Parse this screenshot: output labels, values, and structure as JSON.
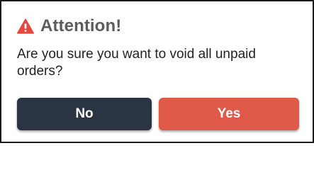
{
  "dialog": {
    "title": "Attention!",
    "icon": "warning-triangle-icon",
    "icon_color": "#e8453c",
    "message": "Are you sure you want to void all unpaid orders?",
    "buttons": {
      "no_label": "No",
      "yes_label": "Yes"
    },
    "colors": {
      "no_button": "#2b3442",
      "yes_button": "#e05a4a",
      "title_text": "#5c5c5c"
    }
  }
}
